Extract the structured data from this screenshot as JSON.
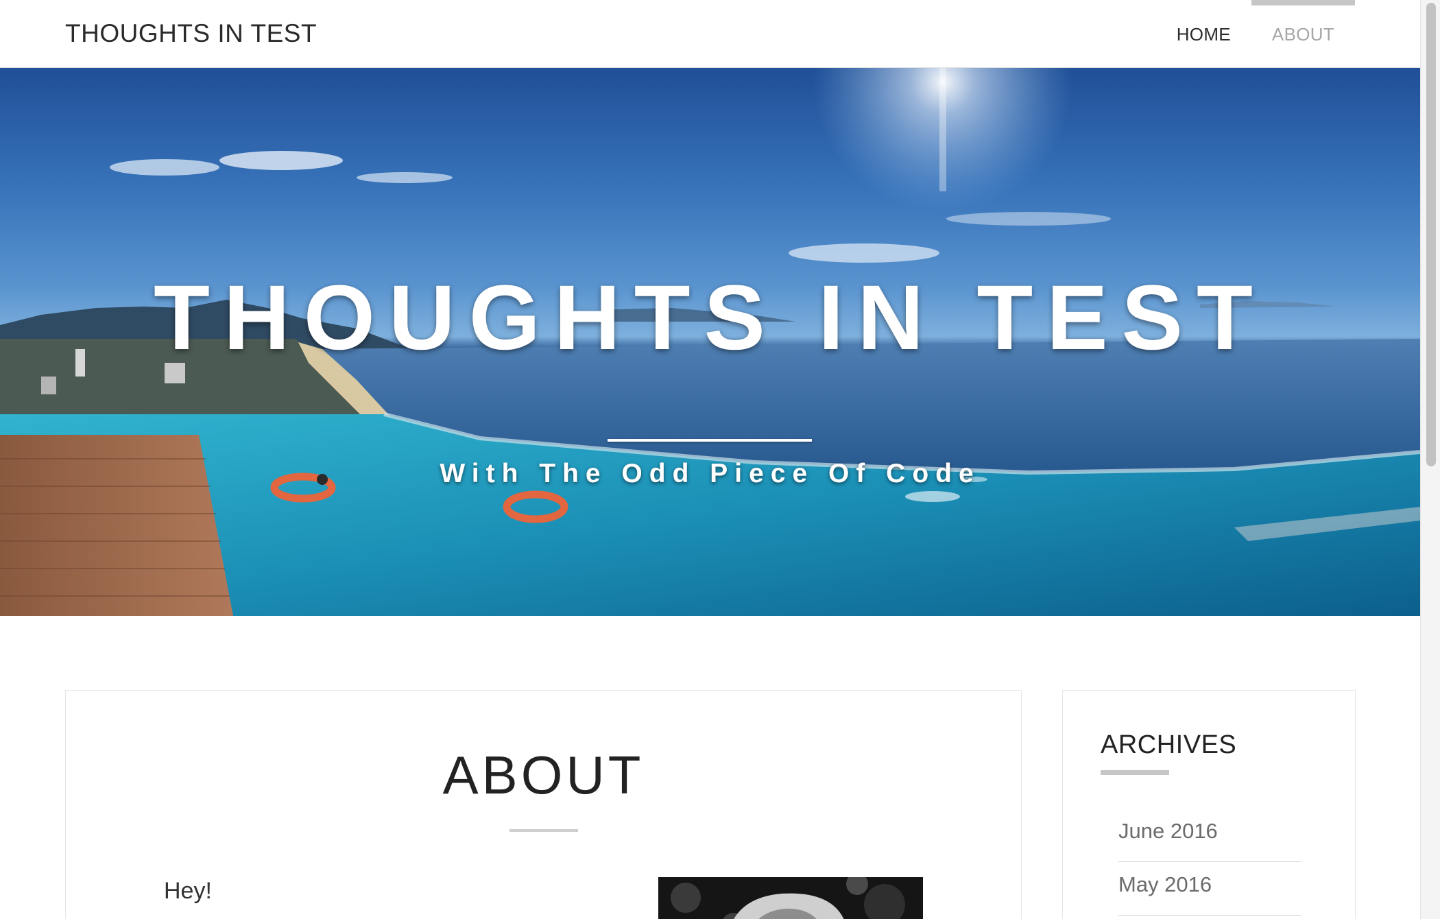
{
  "site": {
    "brand": "THOUGHTS IN TEST",
    "nav": [
      {
        "label": "HOME",
        "active": false
      },
      {
        "label": "ABOUT",
        "active": true
      }
    ]
  },
  "hero": {
    "title": "THOUGHTS IN TEST",
    "subtitle": "With The Odd Piece Of Code"
  },
  "main": {
    "title": "ABOUT",
    "intro": "Hey!"
  },
  "sidebar": {
    "archives_title": "ARCHIVES",
    "archives": [
      "June 2016",
      "May 2016"
    ]
  },
  "colors": {
    "active_nav": "#a6a6a6",
    "accent_bar": "#c6c6c6",
    "text": "#2b2b2b"
  }
}
